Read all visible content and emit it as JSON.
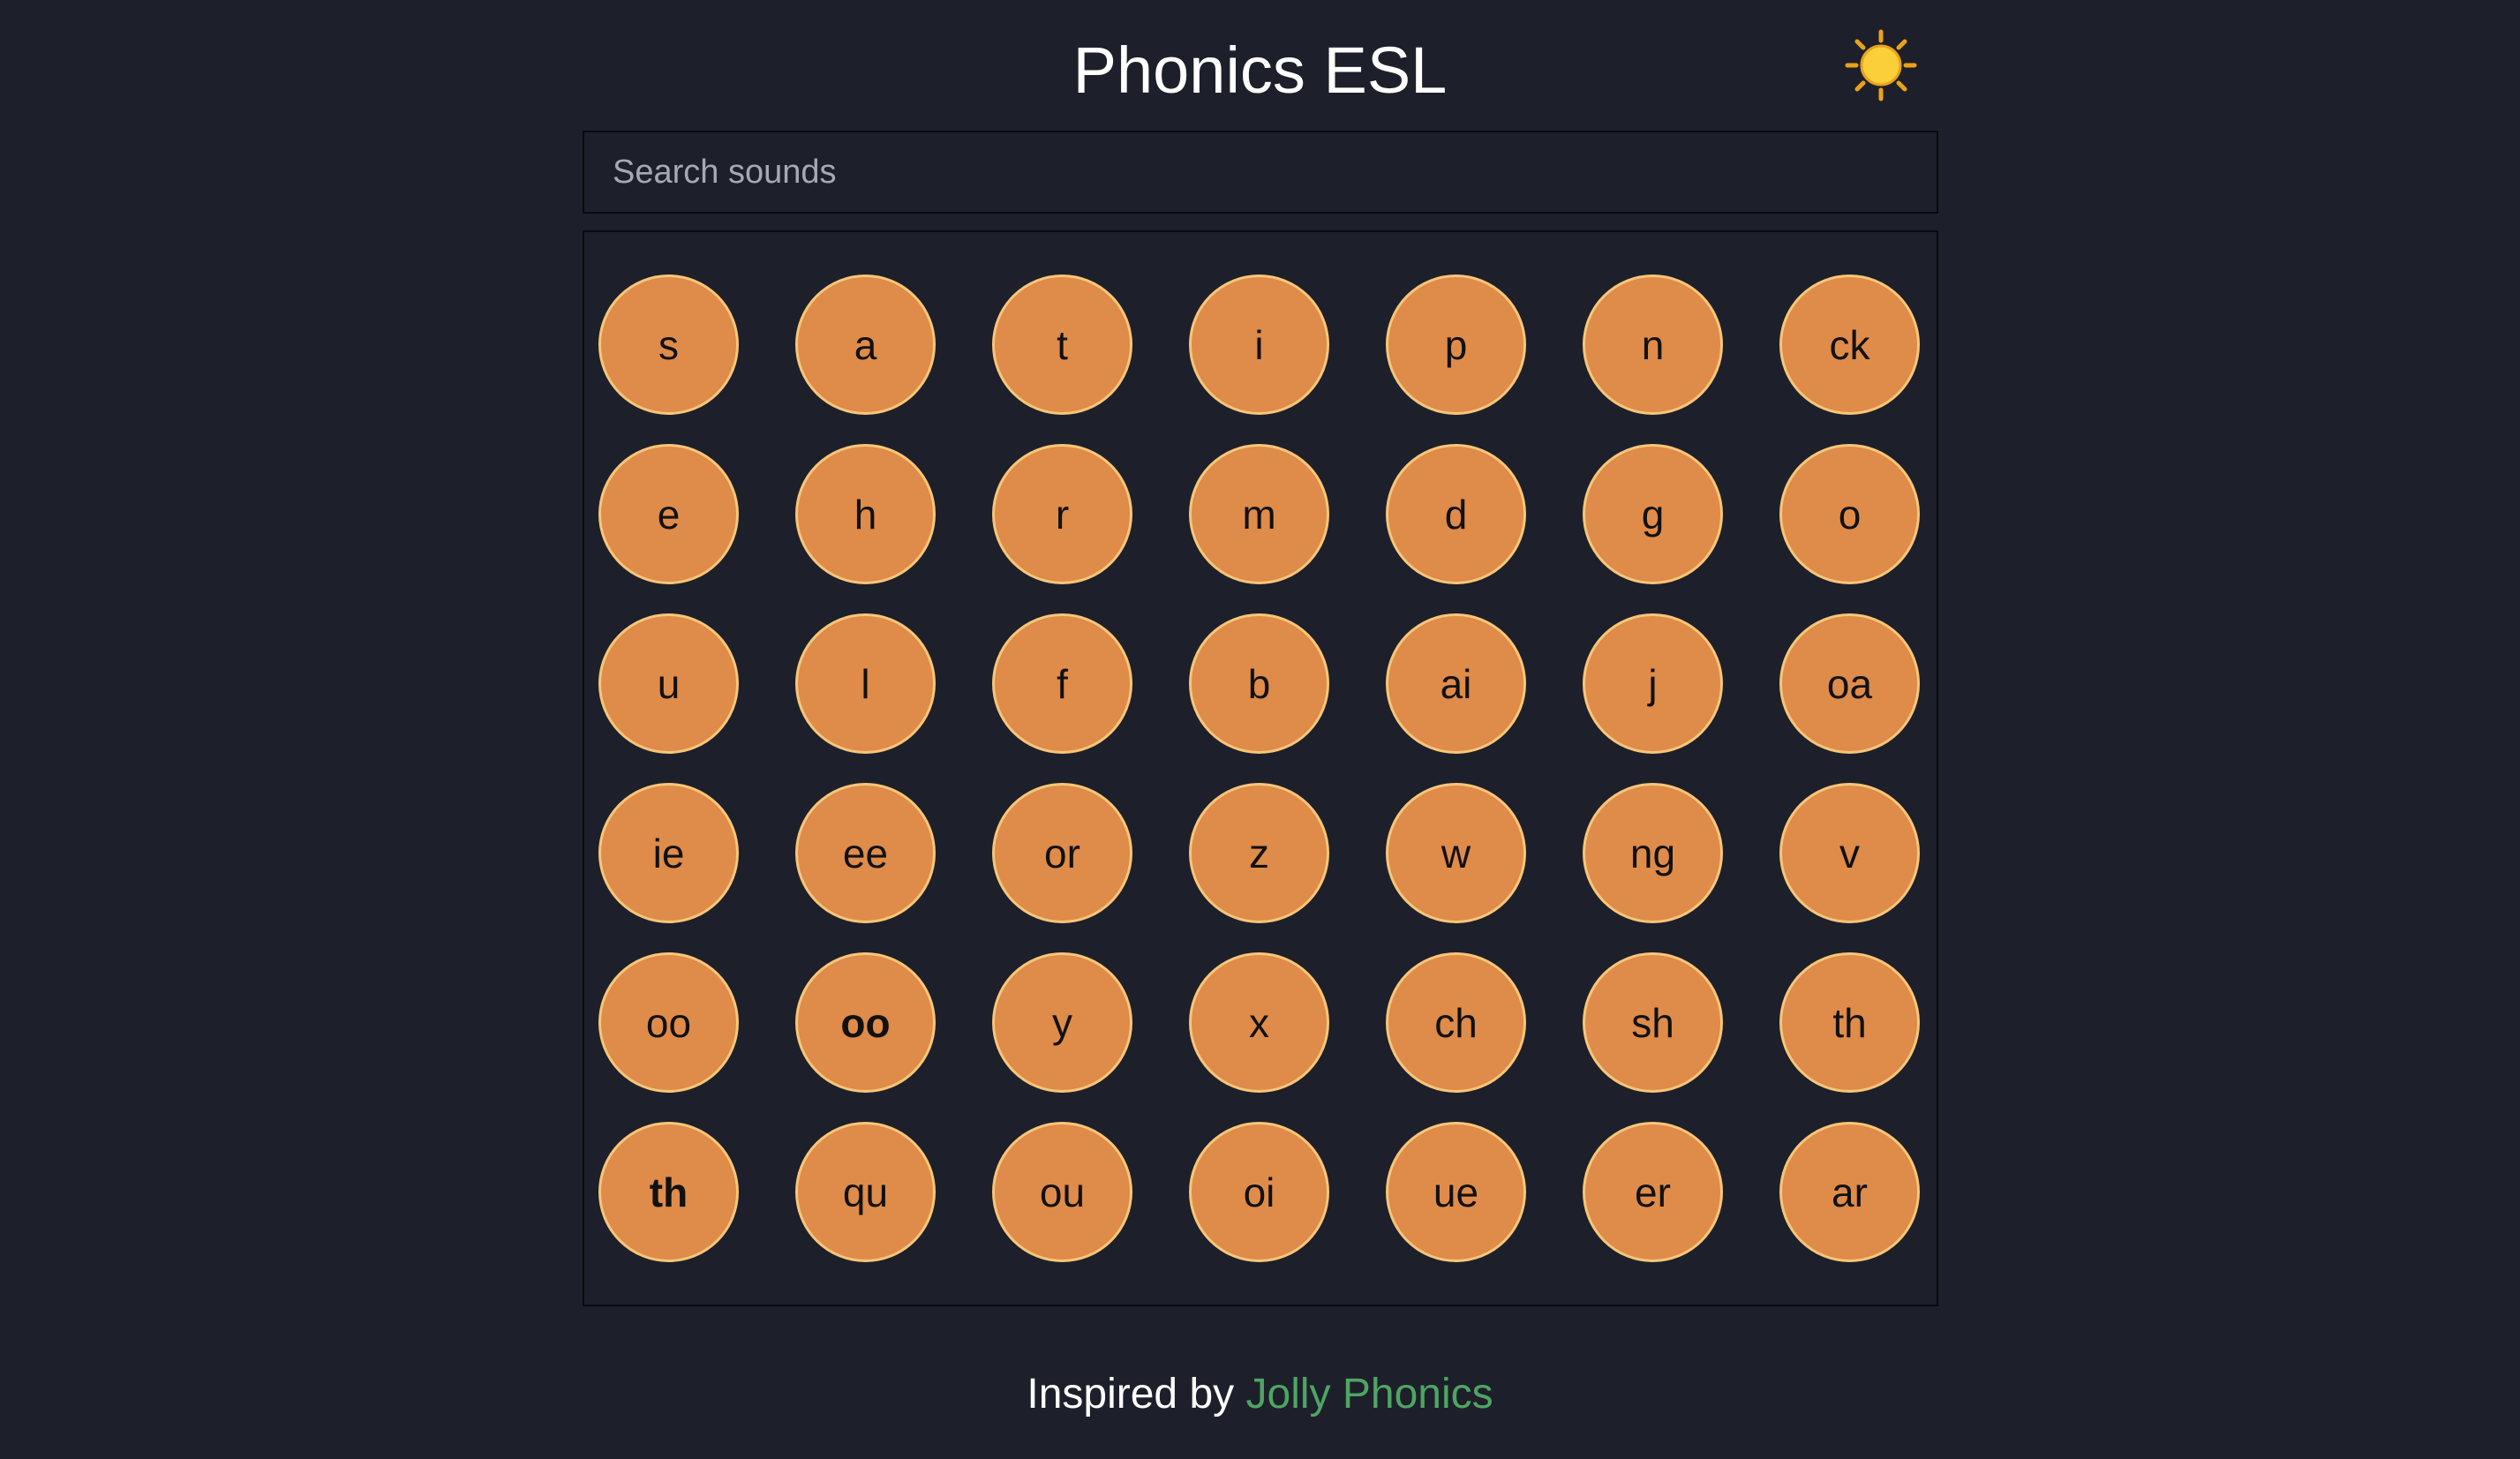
{
  "header": {
    "title": "Phonics ESL",
    "theme_icon": "sun-icon"
  },
  "search": {
    "placeholder": "Search sounds",
    "value": ""
  },
  "sounds": [
    {
      "label": "s",
      "bold": false
    },
    {
      "label": "a",
      "bold": false
    },
    {
      "label": "t",
      "bold": false
    },
    {
      "label": "i",
      "bold": false
    },
    {
      "label": "p",
      "bold": false
    },
    {
      "label": "n",
      "bold": false
    },
    {
      "label": "ck",
      "bold": false
    },
    {
      "label": "e",
      "bold": false
    },
    {
      "label": "h",
      "bold": false
    },
    {
      "label": "r",
      "bold": false
    },
    {
      "label": "m",
      "bold": false
    },
    {
      "label": "d",
      "bold": false
    },
    {
      "label": "g",
      "bold": false
    },
    {
      "label": "o",
      "bold": false
    },
    {
      "label": "u",
      "bold": false
    },
    {
      "label": "l",
      "bold": false
    },
    {
      "label": "f",
      "bold": false
    },
    {
      "label": "b",
      "bold": false
    },
    {
      "label": "ai",
      "bold": false
    },
    {
      "label": "j",
      "bold": false
    },
    {
      "label": "oa",
      "bold": false
    },
    {
      "label": "ie",
      "bold": false
    },
    {
      "label": "ee",
      "bold": false
    },
    {
      "label": "or",
      "bold": false
    },
    {
      "label": "z",
      "bold": false
    },
    {
      "label": "w",
      "bold": false
    },
    {
      "label": "ng",
      "bold": false
    },
    {
      "label": "v",
      "bold": false
    },
    {
      "label": "oo",
      "bold": false
    },
    {
      "label": "oo",
      "bold": true
    },
    {
      "label": "y",
      "bold": false
    },
    {
      "label": "x",
      "bold": false
    },
    {
      "label": "ch",
      "bold": false
    },
    {
      "label": "sh",
      "bold": false
    },
    {
      "label": "th",
      "bold": false
    },
    {
      "label": "th",
      "bold": true
    },
    {
      "label": "qu",
      "bold": false
    },
    {
      "label": "ou",
      "bold": false
    },
    {
      "label": "oi",
      "bold": false
    },
    {
      "label": "ue",
      "bold": false
    },
    {
      "label": "er",
      "bold": false
    },
    {
      "label": "ar",
      "bold": false
    }
  ],
  "footer": {
    "prefix": "Inspired by",
    "link_label": "Jolly Phonics"
  },
  "colors": {
    "background": "#1d202a",
    "button_fill": "#df8b4a",
    "button_border": "#f6c679",
    "link": "#4fa564"
  }
}
